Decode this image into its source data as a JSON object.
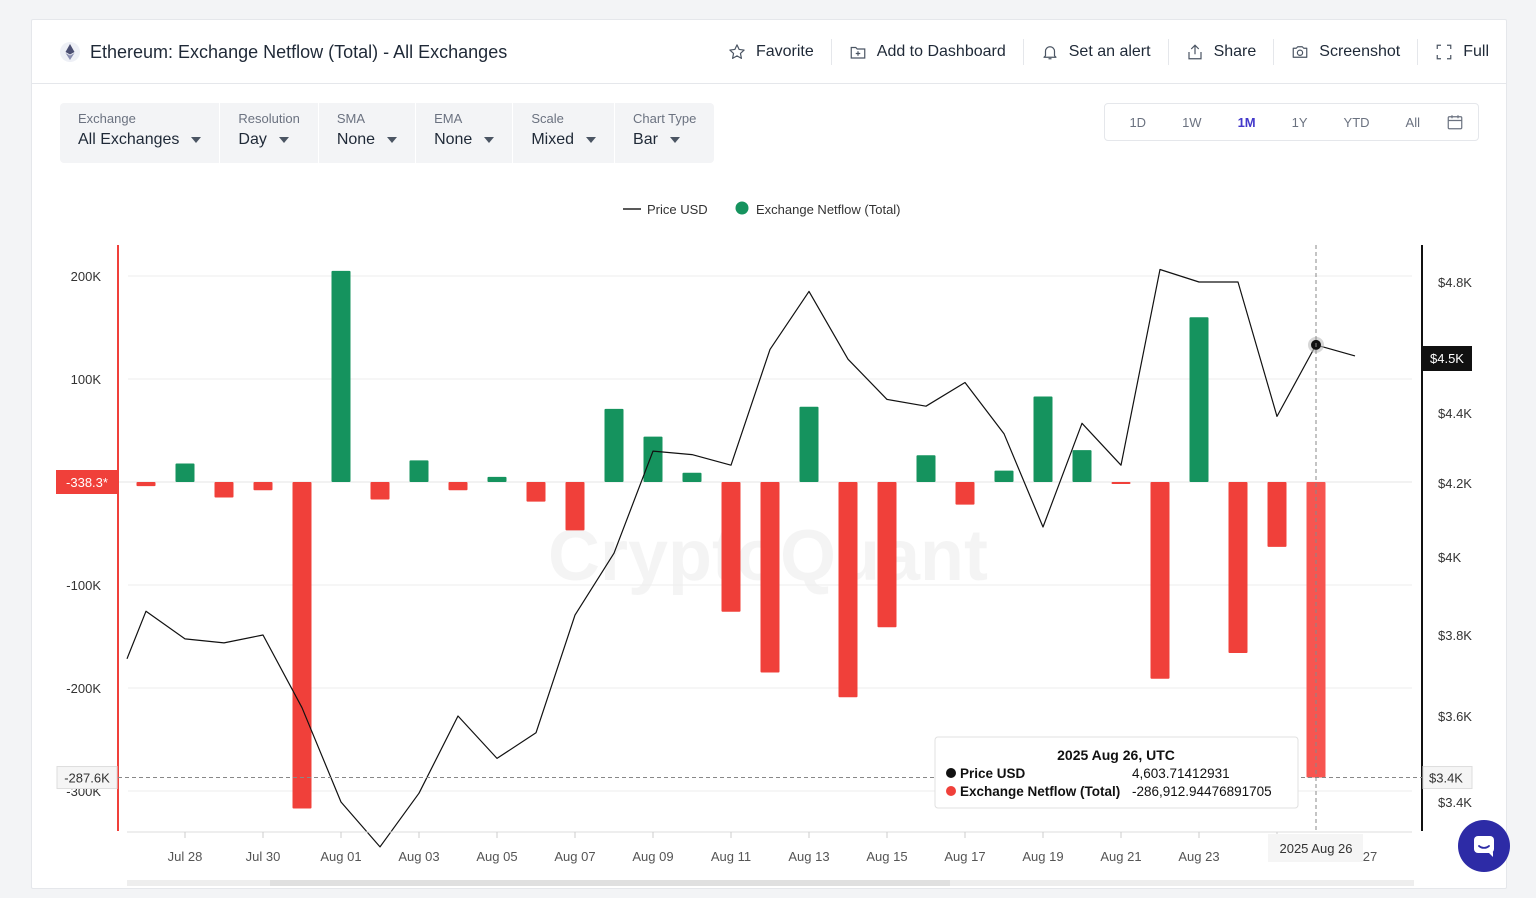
{
  "header": {
    "title": "Ethereum: Exchange Netflow (Total) - All Exchanges",
    "icon": "ethereum-icon",
    "actions": [
      {
        "label": "Favorite",
        "icon": "star-icon"
      },
      {
        "label": "Add to Dashboard",
        "icon": "dashboard-add-icon"
      },
      {
        "label": "Set an alert",
        "icon": "bell-icon"
      },
      {
        "label": "Share",
        "icon": "share-icon"
      },
      {
        "label": "Screenshot",
        "icon": "camera-icon"
      },
      {
        "label": "Full",
        "icon": "fullscreen-icon"
      }
    ]
  },
  "controls": [
    {
      "label": "Exchange",
      "value": "All Exchanges"
    },
    {
      "label": "Resolution",
      "value": "Day"
    },
    {
      "label": "SMA",
      "value": "None"
    },
    {
      "label": "EMA",
      "value": "None"
    },
    {
      "label": "Scale",
      "value": "Mixed"
    },
    {
      "label": "Chart Type",
      "value": "Bar"
    }
  ],
  "ranges": {
    "items": [
      "1D",
      "1W",
      "1M",
      "1Y",
      "YTD",
      "All"
    ],
    "active": "1M",
    "calendar_icon": "calendar-icon"
  },
  "watermark": "CryptoQuant",
  "colors": {
    "positive": "#15935e",
    "negative": "#f0403a",
    "highlight": "#f75550",
    "price_line": "#111111",
    "accent": "#4338ca"
  },
  "chart_data": {
    "type": "bar",
    "legend": [
      {
        "name": "Price USD",
        "type": "line"
      },
      {
        "name": "Exchange Netflow (Total)",
        "type": "bar"
      }
    ],
    "x": [
      "2025-07-27",
      "2025-07-28",
      "2025-07-29",
      "2025-07-30",
      "2025-07-31",
      "2025-08-01",
      "2025-08-02",
      "2025-08-03",
      "2025-08-04",
      "2025-08-05",
      "2025-08-06",
      "2025-08-07",
      "2025-08-08",
      "2025-08-09",
      "2025-08-10",
      "2025-08-11",
      "2025-08-12",
      "2025-08-13",
      "2025-08-14",
      "2025-08-15",
      "2025-08-16",
      "2025-08-17",
      "2025-08-18",
      "2025-08-19",
      "2025-08-20",
      "2025-08-21",
      "2025-08-22",
      "2025-08-23",
      "2025-08-24",
      "2025-08-25",
      "2025-08-26",
      "2025-08-27"
    ],
    "x_tick_labels": [
      "Jul 28",
      "Jul 30",
      "Aug 01",
      "Aug 03",
      "Aug 05",
      "Aug 07",
      "Aug 09",
      "Aug 11",
      "Aug 13",
      "Aug 15",
      "Aug 17",
      "Aug 19",
      "Aug 21",
      "Aug 23",
      "Au",
      "27"
    ],
    "series": [
      {
        "name": "Exchange Netflow (Total)",
        "axis": "left",
        "values": [
          -4000,
          18000,
          -15000,
          -8000,
          -317000,
          205000,
          -17000,
          21000,
          -8000,
          5000,
          -19000,
          -47000,
          71000,
          44000,
          9000,
          -126000,
          -185000,
          73000,
          -209000,
          -141000,
          26000,
          -22000,
          11000,
          83000,
          31000,
          -2000,
          -191000,
          160000,
          -166000,
          -63000,
          -286912.94476891705
        ]
      },
      {
        "name": "Price USD",
        "axis": "right",
        "values": [
          3740,
          3860,
          3790,
          3780,
          3800,
          3620,
          3400,
          3300,
          3420,
          3600,
          3500,
          3560,
          3850,
          4010,
          4290,
          4280,
          4250,
          4590,
          4770,
          4560,
          4440,
          4420,
          4490,
          4340,
          4080,
          4370,
          4250,
          4840,
          4800,
          4800,
          4390,
          4603.71412931,
          4570
        ]
      }
    ],
    "y_left": {
      "ticks": [
        "200K",
        "100K",
        "-100K",
        "-200K",
        "-300K"
      ],
      "min": -340000,
      "max": 232000
    },
    "y_right": {
      "ticks": [
        "$4.8K",
        "$4.4K",
        "$4.2K",
        "$4K",
        "$3.8K",
        "$3.6K",
        "$3.4K"
      ],
      "scale": "log"
    },
    "markers": {
      "left_zero": "-338.3*",
      "left_cursor": "-287.6K",
      "right_cursor": "$3.4K",
      "right_price": "$4.5K",
      "x_cursor": "2025 Aug 26"
    },
    "tooltip": {
      "date": "2025 Aug 26, UTC",
      "rows": [
        {
          "label": "Price USD",
          "value": "4,603.71412931"
        },
        {
          "label": "Exchange Netflow (Total)",
          "value": "-286,912.94476891705"
        }
      ]
    }
  }
}
